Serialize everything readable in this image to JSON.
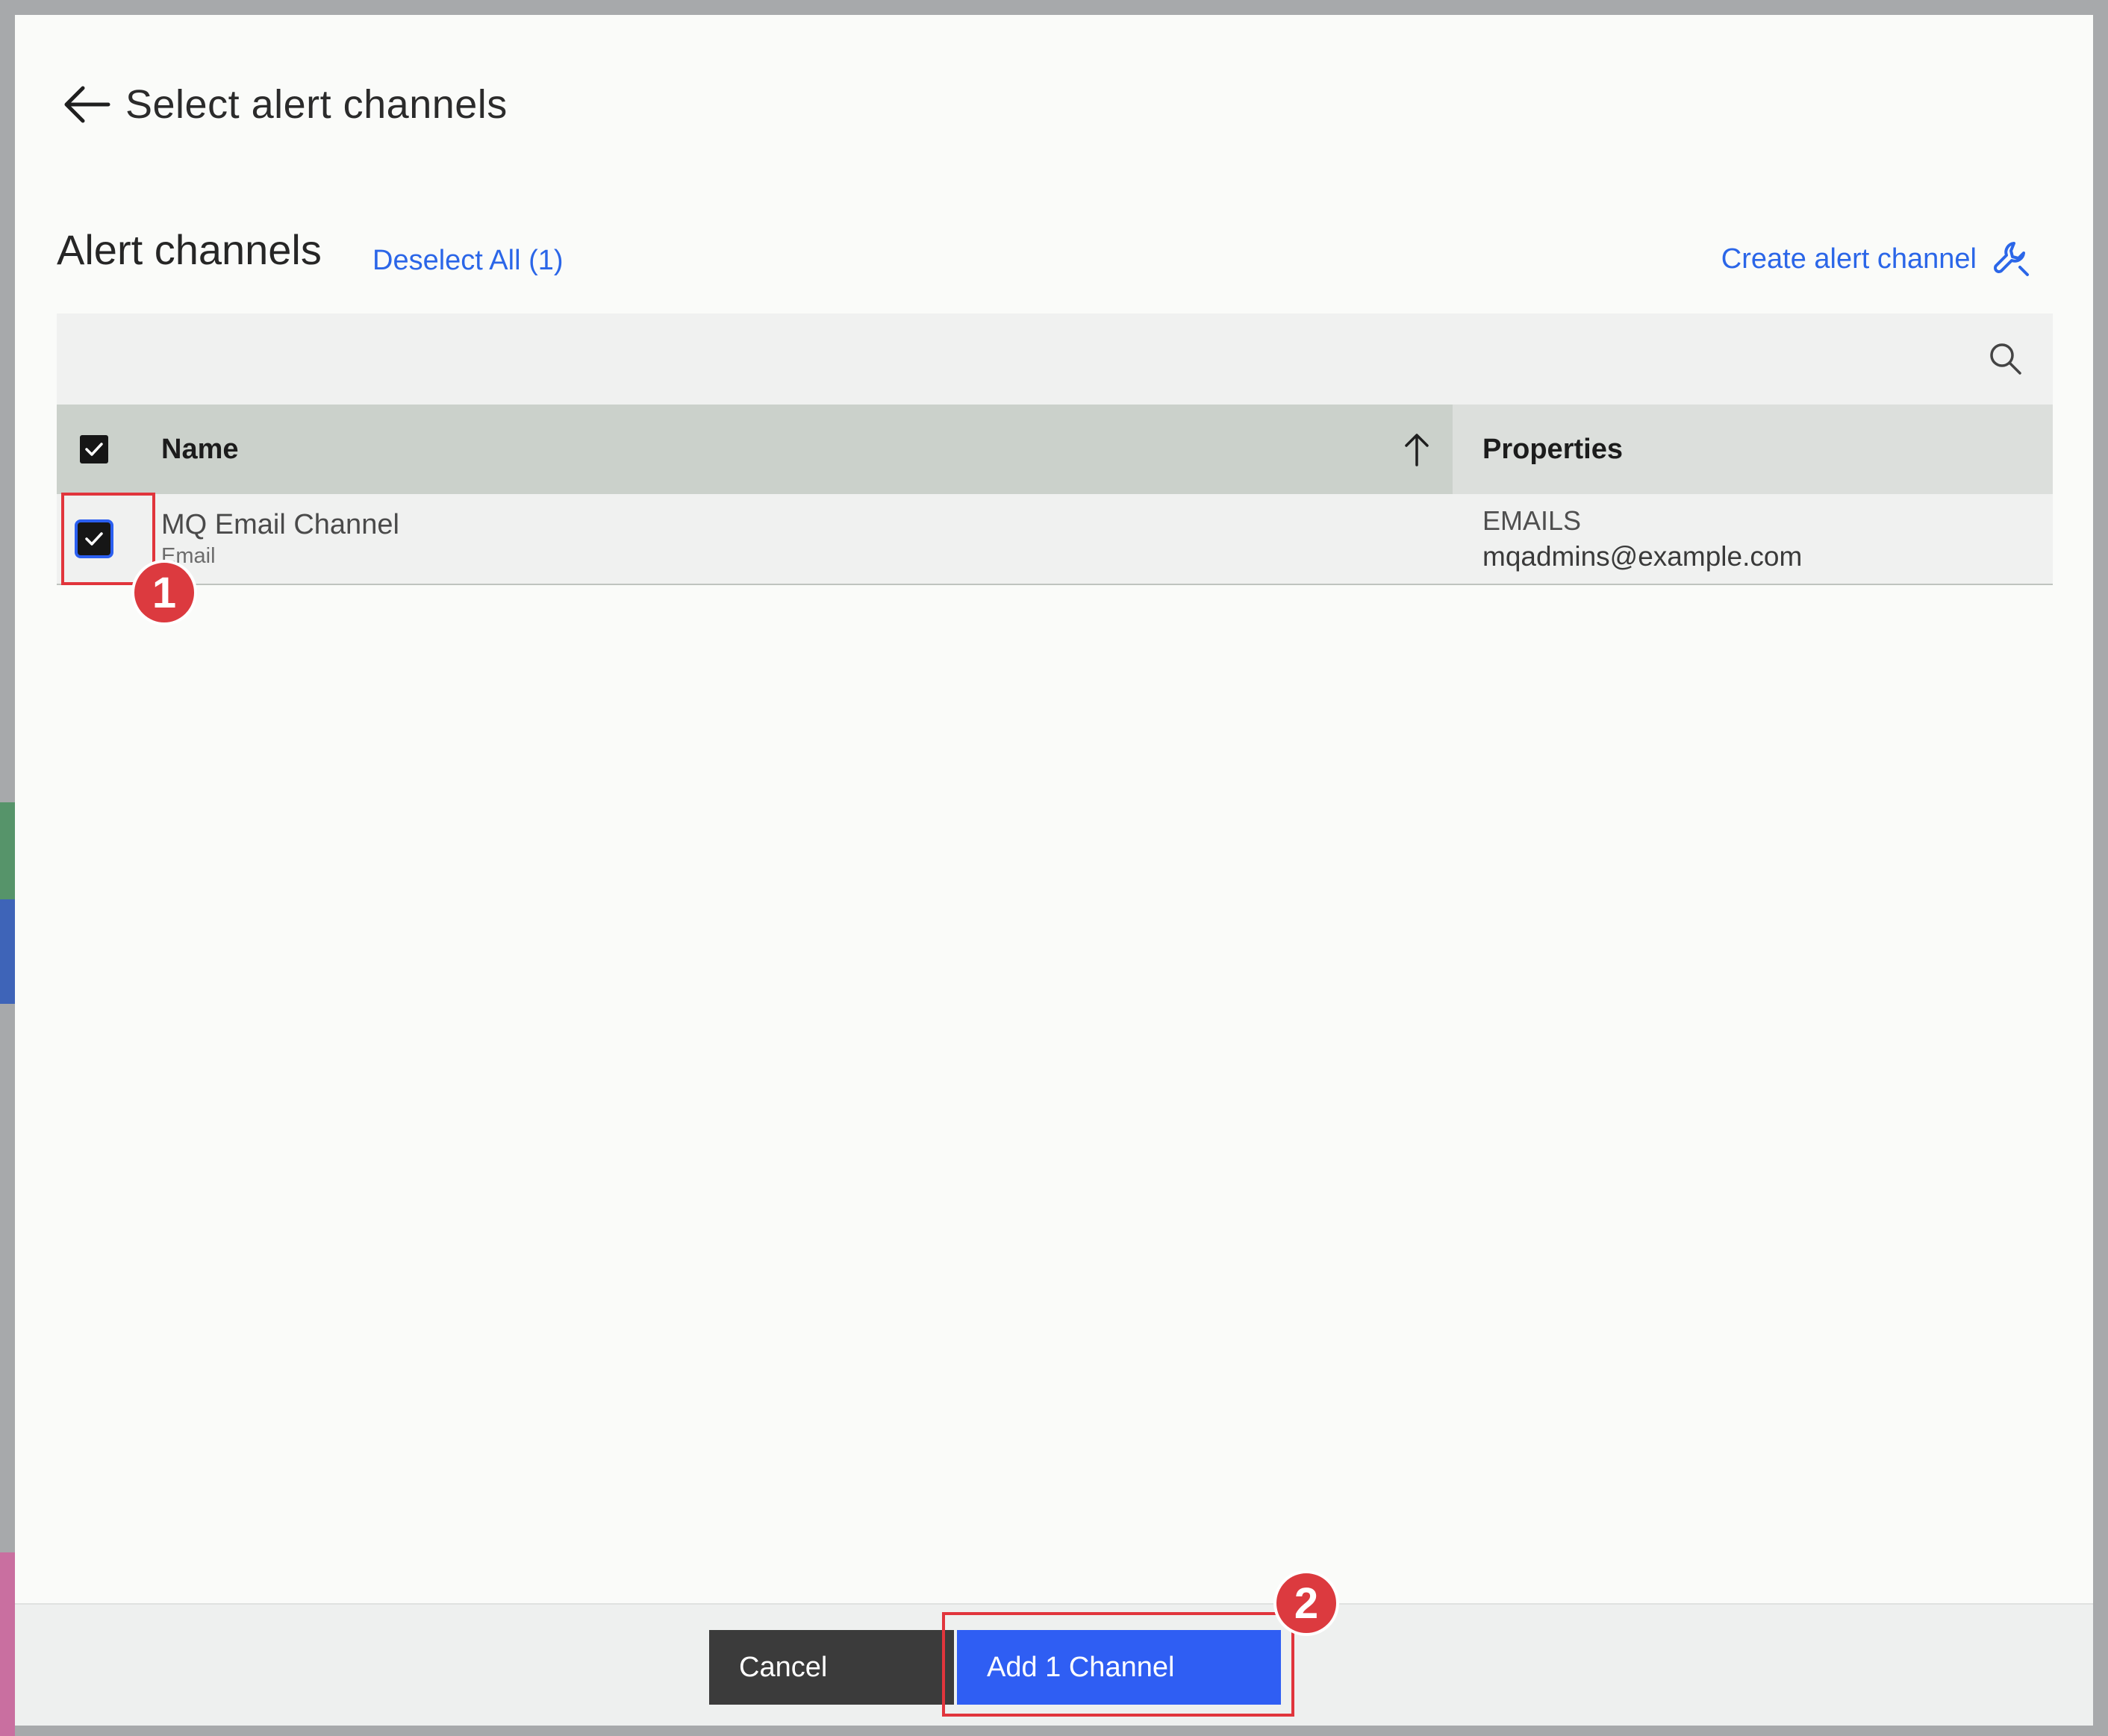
{
  "dialog": {
    "title": "Select alert channels",
    "back_icon": "arrow-left-icon"
  },
  "section": {
    "title": "Alert channels",
    "deselect_all_label": "Deselect All (1)",
    "create_label": "Create alert channel",
    "create_icon": "wrench-icon"
  },
  "toolbar": {
    "search_icon": "search-icon"
  },
  "table": {
    "columns": {
      "name": "Name",
      "properties": "Properties"
    },
    "sort_icon": "arrow-up-icon",
    "header_checked": true,
    "rows": [
      {
        "checked": true,
        "name": "MQ Email Channel",
        "type": "Email",
        "property_label": "EMAILS",
        "property_value": "mqadmins@example.com"
      }
    ]
  },
  "annotations": {
    "step1": "1",
    "step2": "2",
    "color": "#dc3a3f"
  },
  "footer": {
    "cancel_label": "Cancel",
    "primary_label": "Add 1 Channel"
  },
  "colors": {
    "accent": "#2f5ef3",
    "link": "#2b66e8"
  }
}
